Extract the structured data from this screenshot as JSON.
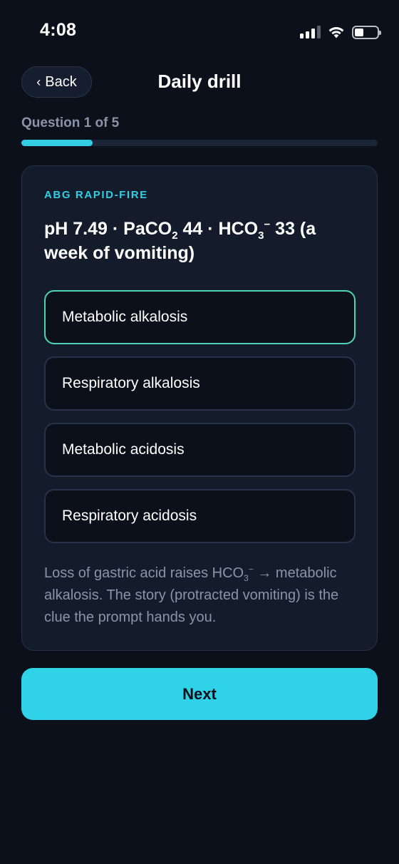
{
  "status_bar": {
    "time": "4:08",
    "icons": [
      "cellular-signal-icon",
      "wifi-icon",
      "battery-icon"
    ]
  },
  "header": {
    "back_label": "Back",
    "title": "Daily drill"
  },
  "progress": {
    "label": "Question 1 of 5",
    "current": 1,
    "total": 5,
    "fraction": 0.2
  },
  "card": {
    "eyebrow": "ABG RAPID-FIRE",
    "question": {
      "ph": "pH 7.49 · PaCO",
      "paco2_sub": "2",
      "paco2_value": " 44 · HCO",
      "hco3_sub": "3",
      "hco3_sup": "−",
      "rest": " 33  (a week of vomiting)"
    },
    "options": [
      {
        "label": "Metabolic alkalosis",
        "selected": true
      },
      {
        "label": "Respiratory alkalosis",
        "selected": false
      },
      {
        "label": "Metabolic acidosis",
        "selected": false
      },
      {
        "label": "Respiratory acidosis",
        "selected": false
      }
    ],
    "explanation": {
      "part1": "Loss of gastric acid raises HCO",
      "sub": "3",
      "sup": "−",
      "part2": " → metabolic alkalosis. The story (protracted vomiting) is the clue the prompt hands you."
    }
  },
  "next_label": "Next",
  "colors": {
    "background": "#0b101b",
    "card": "#141c2c",
    "accent": "#33cde3",
    "selected_border": "#4fd4b3",
    "muted_text": "#8a93a8"
  }
}
